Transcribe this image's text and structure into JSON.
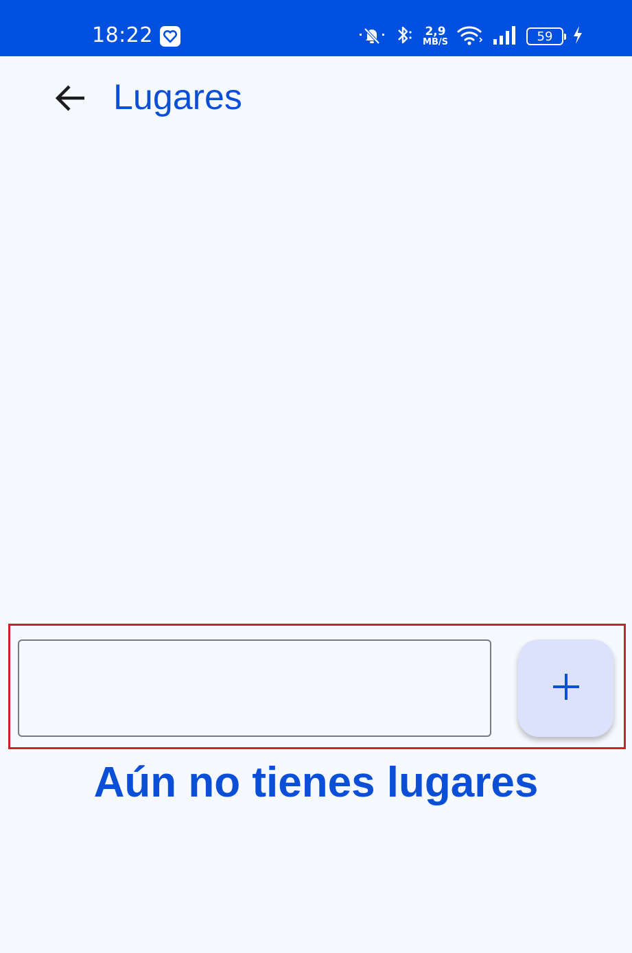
{
  "status_bar": {
    "time": "18:22",
    "network_speed_value": "2,9",
    "network_speed_unit": "MB/S",
    "battery_level": "59",
    "icons": [
      "heart-app-icon",
      "mute-bell-icon",
      "bluetooth-icon",
      "wifi-icon",
      "signal-icon",
      "battery-icon",
      "charging-icon"
    ]
  },
  "app_bar": {
    "back_icon": "arrow-left-icon",
    "title": "Lugares"
  },
  "form": {
    "input_value": "",
    "input_placeholder": "",
    "add_icon": "plus-icon"
  },
  "empty_state": {
    "message": "Aún no tienes lugares"
  },
  "colors": {
    "status_bar": "#0050e0",
    "background": "#f6f9fe",
    "accent": "#0b4fd6",
    "button_fill": "#dce2fb",
    "highlight": "#d0202a"
  }
}
